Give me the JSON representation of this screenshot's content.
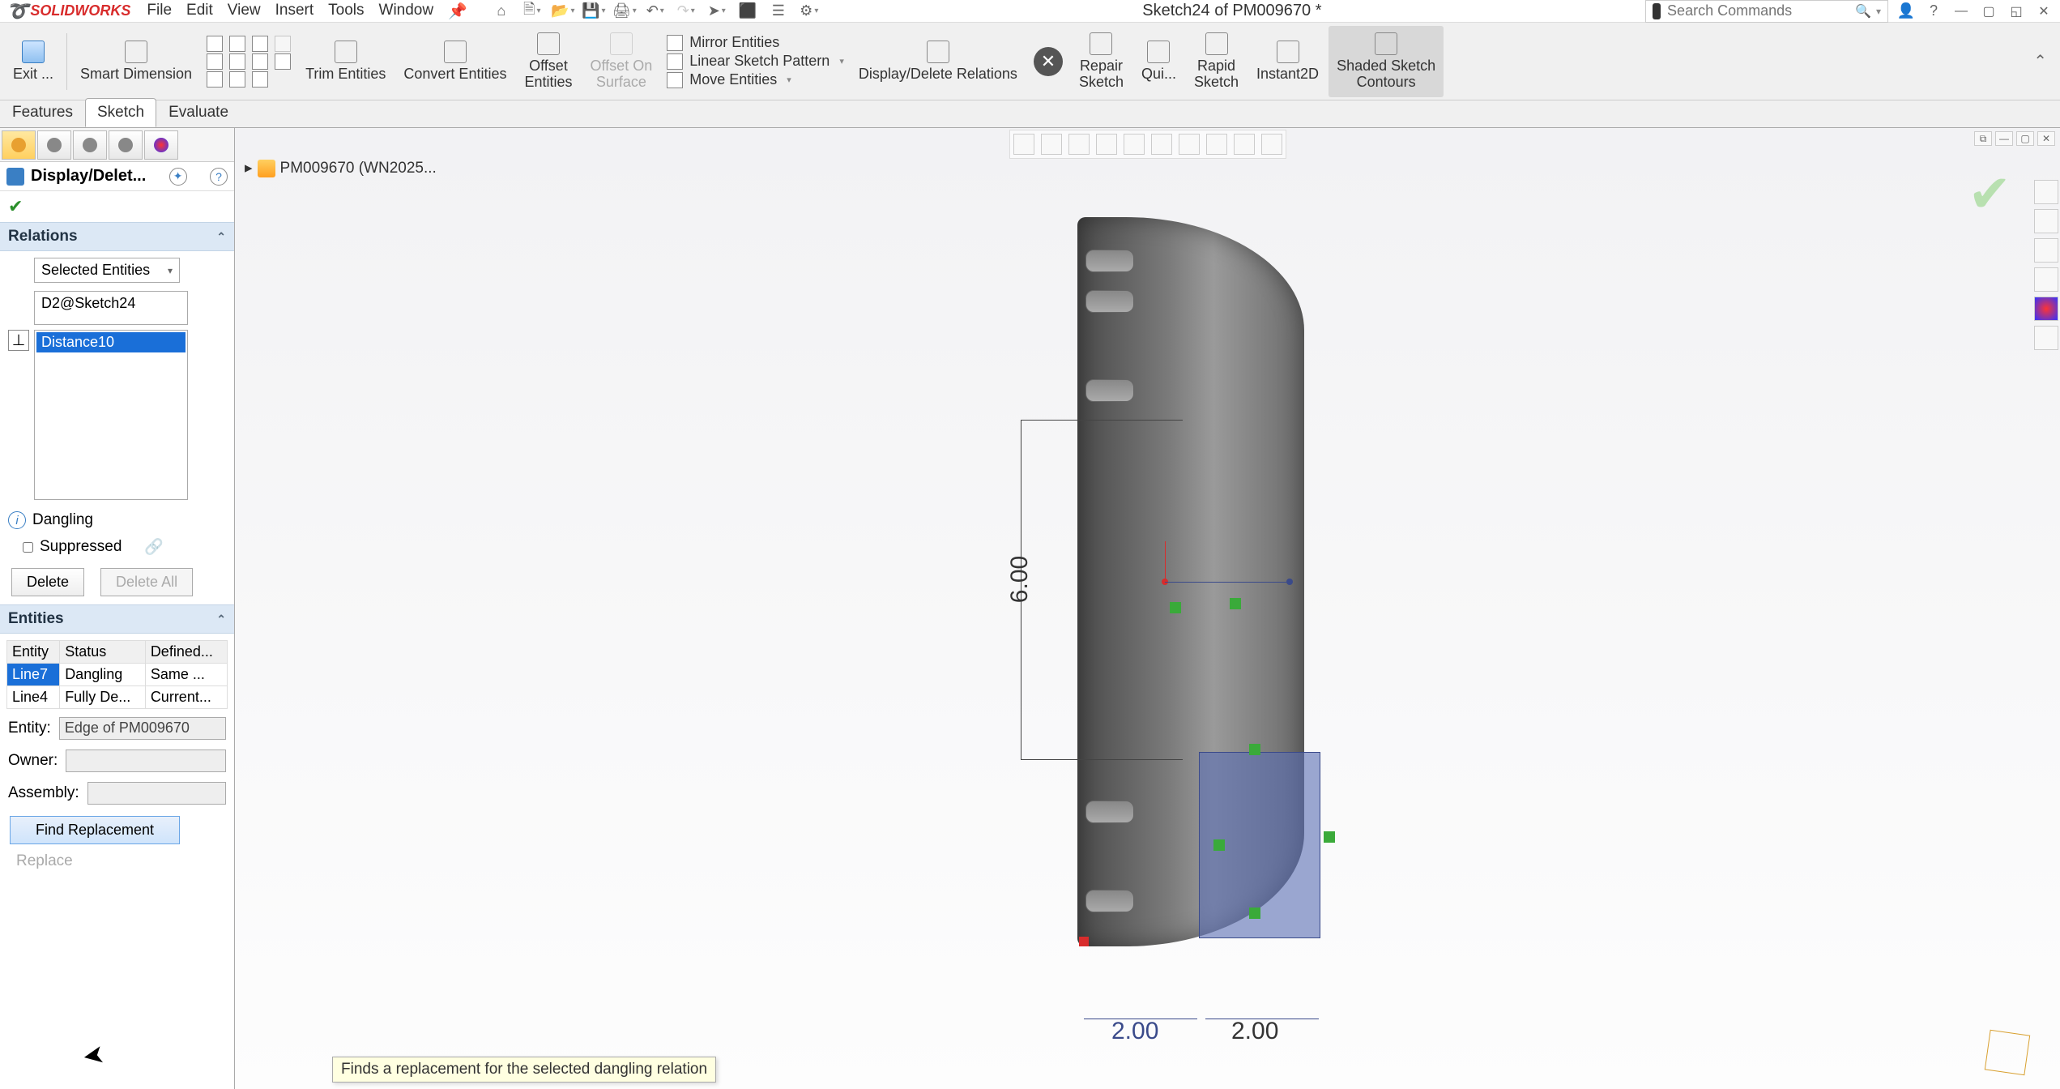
{
  "app": {
    "logo": "SOLIDWORKS",
    "title": "Sketch24 of PM009670 *"
  },
  "menu": {
    "file": "File",
    "edit": "Edit",
    "view": "View",
    "insert": "Insert",
    "tools": "Tools",
    "window": "Window"
  },
  "search": {
    "placeholder": "Search Commands"
  },
  "ribbon": {
    "exit": "Exit ...",
    "smart_dim": "Smart Dimension",
    "trim": "Trim Entities",
    "convert": "Convert Entities",
    "offset": "Offset\nEntities",
    "offset_surface": "Offset On\nSurface",
    "mirror": "Mirror Entities",
    "linear": "Linear Sketch Pattern",
    "move": "Move Entities",
    "ddr": "Display/Delete Relations",
    "repair": "Repair\nSketch",
    "qui": "Qui...",
    "rapid": "Rapid\nSketch",
    "instant": "Instant2D",
    "shaded": "Shaded Sketch\nContours"
  },
  "tabs": {
    "features": "Features",
    "sketch": "Sketch",
    "evaluate": "Evaluate"
  },
  "breadcrumb": "PM009670 (WN2025...",
  "pm": {
    "title": "Display/Delet...",
    "relations_hdr": "Relations",
    "dropdown_val": "Selected Entities",
    "rel_input": "D2@Sketch24",
    "rel_item": "Distance10",
    "dangling": "Dangling",
    "suppressed": "Suppressed",
    "delete": "Delete",
    "delete_all": "Delete All",
    "entities_hdr": "Entities",
    "col_entity": "Entity",
    "col_status": "Status",
    "col_defined": "Defined...",
    "row1_entity": "Line7",
    "row1_status": "Dangling",
    "row1_def": "Same ...",
    "row2_entity": "Line4",
    "row2_status": "Fully De...",
    "row2_def": "Current...",
    "lbl_entity": "Entity:",
    "val_entity": "Edge of PM009670",
    "lbl_owner": "Owner:",
    "lbl_assembly": "Assembly:",
    "find_btn": "Find Replacement",
    "replace_btn": "Replace"
  },
  "tooltip": "Finds a replacement for the selected dangling relation",
  "dims": {
    "v": "6.00",
    "h1": "2.00",
    "h2": "2.00"
  }
}
